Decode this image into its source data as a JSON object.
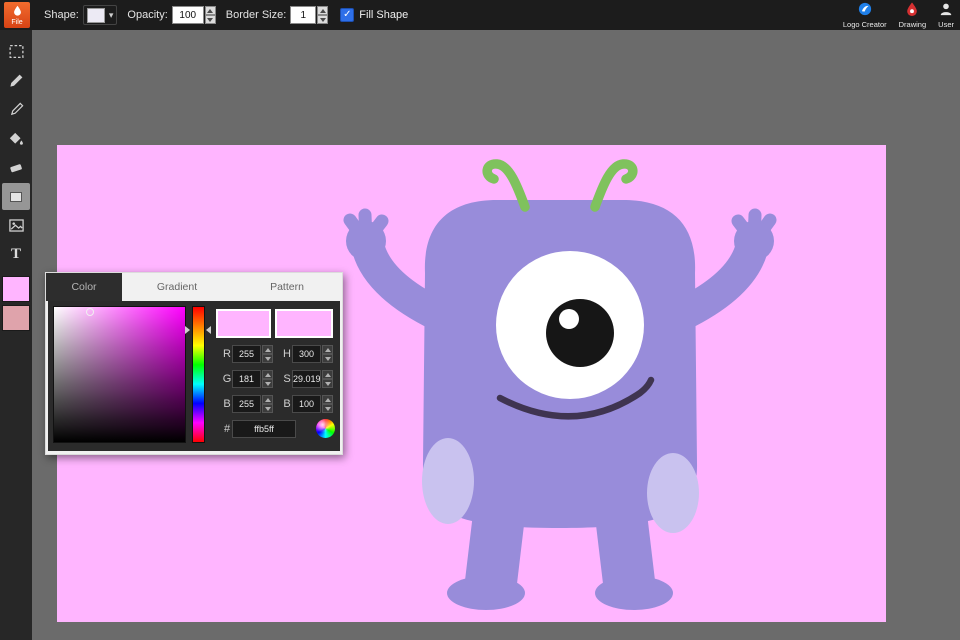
{
  "topbar": {
    "file": {
      "label": "File"
    },
    "shape": {
      "label": "Shape:"
    },
    "opacity": {
      "label": "Opacity:",
      "value": "100"
    },
    "border_size": {
      "label": "Border Size:",
      "value": "1"
    },
    "fill_shape": {
      "label": "Fill Shape",
      "checked": true
    },
    "apps": [
      {
        "label": "Logo Creator",
        "icon": "logo-creator-icon"
      },
      {
        "label": "Drawing",
        "icon": "drawing-icon"
      },
      {
        "label": "User",
        "icon": "user-icon"
      }
    ]
  },
  "tools": {
    "items": [
      "marquee",
      "pencil",
      "pen",
      "fill-bucket",
      "eraser",
      "shape",
      "image",
      "text"
    ],
    "selected_tool": "shape",
    "text_tool_glyph": "T",
    "primary_color": "#ffb5ff",
    "secondary_color": "#dfa3ab"
  },
  "color_picker": {
    "tabs": [
      {
        "label": "Color",
        "active": true
      },
      {
        "label": "Gradient",
        "active": false
      },
      {
        "label": "Pattern",
        "active": false
      }
    ],
    "rgb": {
      "r_label": "R",
      "r": "255",
      "g_label": "G",
      "g": "181",
      "b_label": "B",
      "b": "255"
    },
    "hsb": {
      "h_label": "H",
      "h": "300",
      "s_label": "S",
      "s": "29.0196",
      "b_label": "B",
      "b": "100"
    },
    "hex_prefix": "#",
    "hex": "ffb5ff",
    "current_color": "#ffb5ff"
  },
  "canvas": {
    "background_color": "#ffb5ff",
    "artwork": "purple one-eyed monster with green antennae"
  },
  "accent_colors": {
    "checkbox_blue": "#2e6fe8",
    "file_button_orange": "#e8552e",
    "monster_purple": "#988cda",
    "monster_spot": "#c9c2ef",
    "antenna_green": "#7fc25d"
  }
}
